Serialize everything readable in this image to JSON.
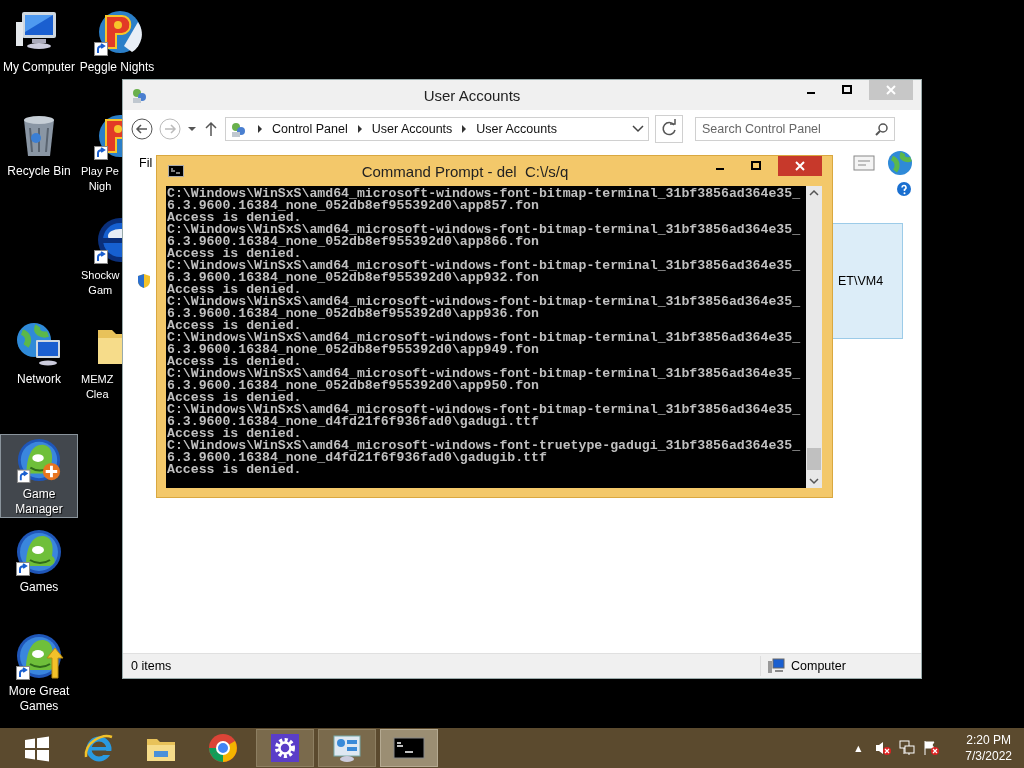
{
  "desktop_columns": [
    [
      {
        "kind": "computer",
        "labels": [
          "My Computer"
        ],
        "shortcut": false,
        "selected": false,
        "clipped": false
      },
      {
        "kind": "bin",
        "labels": [
          "Recycle Bin"
        ],
        "shortcut": false,
        "selected": false,
        "clipped": false
      },
      {
        "kind": "network",
        "labels": [
          "Network"
        ],
        "shortcut": false,
        "selected": false,
        "clipped": false
      },
      {
        "kind": "fish-plus",
        "labels": [
          "Game",
          "Manager"
        ],
        "shortcut": true,
        "selected": true,
        "clipped": false
      },
      {
        "kind": "fish",
        "labels": [
          "Games"
        ],
        "shortcut": true,
        "selected": false,
        "clipped": false
      },
      {
        "kind": "fish-arrow",
        "labels": [
          "More Great",
          "Games"
        ],
        "shortcut": true,
        "selected": false,
        "clipped": false
      }
    ],
    [
      {
        "kind": "peggle",
        "labels": [
          "Peggle Nights"
        ],
        "shortcut": true,
        "selected": false,
        "clipped": false
      },
      {
        "kind": "peggle",
        "labels": [
          "Play Pe",
          "Nigh"
        ],
        "shortcut": true,
        "selected": false,
        "clipped": true
      },
      {
        "kind": "shockwave",
        "labels": [
          "Shockw",
          "Gam"
        ],
        "shortcut": true,
        "selected": false,
        "clipped": true
      },
      {
        "kind": "folder",
        "labels": [
          "MEMZ",
          "Clea"
        ],
        "shortcut": false,
        "selected": false,
        "clipped": true
      }
    ]
  ],
  "explorer": {
    "title": "User Accounts",
    "breadcrumbs": [
      "Control Panel",
      "User Accounts",
      "User Accounts"
    ],
    "search": {
      "placeholder": "Search Control Panel"
    },
    "menu_fragment": "Fil",
    "panel_text": "ET\\VM4",
    "status_bar": {
      "items": "0 items",
      "location": "Computer"
    }
  },
  "console": {
    "title": "Command Prompt - del  C:\\/s/q",
    "lines": [
      "C:\\Windows\\WinSxS\\amd64_microsoft-windows-font-bitmap-terminal_31bf3856ad364e35_",
      "6.3.9600.16384_none_052db8ef955392d0\\app857.fon",
      "Access is denied.",
      "C:\\Windows\\WinSxS\\amd64_microsoft-windows-font-bitmap-terminal_31bf3856ad364e35_",
      "6.3.9600.16384_none_052db8ef955392d0\\app866.fon",
      "Access is denied.",
      "C:\\Windows\\WinSxS\\amd64_microsoft-windows-font-bitmap-terminal_31bf3856ad364e35_",
      "6.3.9600.16384_none_052db8ef955392d0\\app932.fon",
      "Access is denied.",
      "C:\\Windows\\WinSxS\\amd64_microsoft-windows-font-bitmap-terminal_31bf3856ad364e35_",
      "6.3.9600.16384_none_052db8ef955392d0\\app936.fon",
      "Access is denied.",
      "C:\\Windows\\WinSxS\\amd64_microsoft-windows-font-bitmap-terminal_31bf3856ad364e35_",
      "6.3.9600.16384_none_052db8ef955392d0\\app949.fon",
      "Access is denied.",
      "C:\\Windows\\WinSxS\\amd64_microsoft-windows-font-bitmap-terminal_31bf3856ad364e35_",
      "6.3.9600.16384_none_052db8ef955392d0\\app950.fon",
      "Access is denied.",
      "C:\\Windows\\WinSxS\\amd64_microsoft-windows-font-bitmap-terminal_31bf3856ad364e35_",
      "6.3.9600.16384_none_d4fd21f6f936fad0\\gadugi.ttf",
      "Access is denied.",
      "C:\\Windows\\WinSxS\\amd64_microsoft-windows-font-truetype-gadugi_31bf3856ad364e35_",
      "6.3.9600.16384_none_d4fd21f6f936fad0\\gadugib.ttf",
      "Access is denied."
    ]
  },
  "taskbar": {
    "buttons": [
      {
        "kind": "start",
        "open": false,
        "selected": false
      },
      {
        "kind": "ie",
        "open": false,
        "selected": false
      },
      {
        "kind": "explorer",
        "open": false,
        "selected": false
      },
      {
        "kind": "chrome",
        "open": false,
        "selected": false
      },
      {
        "kind": "gear",
        "open": true,
        "selected": false
      },
      {
        "kind": "control-panel",
        "open": true,
        "selected": false
      },
      {
        "kind": "cmd",
        "open": true,
        "selected": true
      }
    ],
    "tray": {
      "up": "▲",
      "time": "2:20 PM",
      "date": "7/3/2022"
    }
  }
}
